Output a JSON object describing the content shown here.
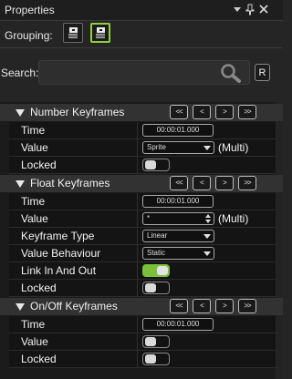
{
  "panel": {
    "title": "Properties"
  },
  "titlebar_icons": [
    "dropdown-icon",
    "pin-icon",
    "close-icon"
  ],
  "grouping": {
    "label": "Grouping:",
    "buttons": [
      "categorized-icon",
      "alphabetical-icon"
    ],
    "active_index": 1
  },
  "search": {
    "label": "Search:",
    "value": "",
    "reset_label": "R"
  },
  "nav_labels": {
    "first": "<<",
    "prev": "<",
    "next": ">",
    "last": ">>"
  },
  "sections": [
    {
      "title": "Number Keyframes",
      "rows": [
        {
          "label": "Time",
          "kind": "text",
          "value": "00:00:01.000"
        },
        {
          "label": "Value",
          "kind": "dropdown",
          "value": "Sprite",
          "suffix": "(Multi)"
        },
        {
          "label": "Locked",
          "kind": "toggle",
          "checked": false
        }
      ]
    },
    {
      "title": "Float Keyframes",
      "rows": [
        {
          "label": "Time",
          "kind": "text",
          "value": "00:00:01.000"
        },
        {
          "label": "Value",
          "kind": "spinner",
          "value": "*",
          "suffix": "(Multi)"
        },
        {
          "label": "Keyframe Type",
          "kind": "dropdown",
          "value": "Linear"
        },
        {
          "label": "Value Behaviour",
          "kind": "dropdown",
          "value": "Static"
        },
        {
          "label": "Link In And Out",
          "kind": "toggle",
          "checked": true
        },
        {
          "label": "Locked",
          "kind": "toggle",
          "checked": false
        }
      ]
    },
    {
      "title": "On/Off Keyframes",
      "rows": [
        {
          "label": "Time",
          "kind": "text",
          "value": "00:00:01.000"
        },
        {
          "label": "Value",
          "kind": "toggle",
          "checked": false
        },
        {
          "label": "Locked",
          "kind": "toggle",
          "checked": false
        }
      ]
    }
  ],
  "colors": {
    "accent": "#8fd13c",
    "toggle_on": "#7ac13a",
    "background": "#252525",
    "grid": "#141414"
  }
}
